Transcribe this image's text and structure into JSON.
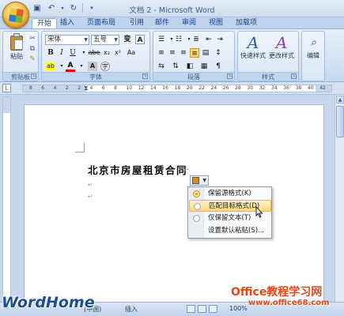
{
  "window": {
    "title": "文档 2 - Microsoft Word"
  },
  "tabs": [
    "开始",
    "插入",
    "页面布局",
    "引用",
    "邮件",
    "审阅",
    "视图",
    "加载项"
  ],
  "ribbon": {
    "clipboard": {
      "paste_label": "粘贴",
      "group_label": "剪贴板"
    },
    "font": {
      "font_name": "宋体",
      "font_size": "五号",
      "group_label": "字体",
      "bold": "B",
      "italic": "I",
      "underline": "U",
      "strike": "abe",
      "subscript": "x₂",
      "superscript": "x²",
      "font_color": "A",
      "phonetic": "变",
      "enclose": "A",
      "char_border": "Aa",
      "char_shade": "A",
      "circle": "字"
    },
    "paragraph": {
      "group_label": "段落"
    },
    "styles": {
      "quick_styles_label": "快速样式",
      "change_styles_label": "更改样式",
      "group_label": "样式"
    },
    "editing": {
      "label": "编辑"
    }
  },
  "ruler": {
    "numbers": [
      "8",
      "6",
      "4",
      "2",
      "2",
      "4",
      "6",
      "8",
      "10",
      "12",
      "14",
      "16",
      "18",
      "20",
      "22",
      "24",
      "26",
      "28",
      "30",
      "32",
      "34",
      "36",
      "38",
      "40",
      "42"
    ]
  },
  "document": {
    "heading": "北京市房屋租赁合同",
    "para_mark": "↵"
  },
  "paste_options": {
    "items": [
      {
        "label": "保留源格式(K)",
        "selected": true,
        "highlighted": false
      },
      {
        "label": "匹配目标格式(D)",
        "selected": false,
        "highlighted": true
      },
      {
        "label": "仅保留文本(T)",
        "selected": false,
        "highlighted": false
      },
      {
        "label": "设置默认粘贴(S)...",
        "selected": false,
        "highlighted": false
      }
    ]
  },
  "status": {
    "language": "(中国)",
    "mode": "插入",
    "zoom": "100%"
  },
  "watermarks": {
    "left": "WordHome",
    "right": "Office教程学习网",
    "right_url": "www.office68.com"
  }
}
